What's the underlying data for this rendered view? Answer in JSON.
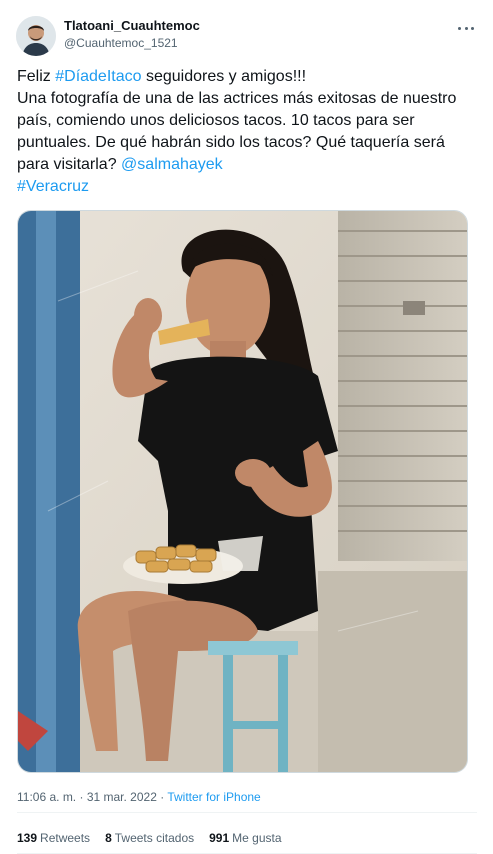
{
  "author": {
    "display_name": "Tlatoani_Cuauhtemoc",
    "handle": "@Cuauhtemoc_1521"
  },
  "tweet": {
    "line1_prefix": "Feliz ",
    "hashtag_dia": "#DíadeItaco",
    "line1_suffix": " seguidores y amigos!!!",
    "line2": "Una fotografía de una de las actrices más exitosas de nuestro país, comiendo unos deliciosos tacos. 10 tacos para ser puntuales. De qué habrán sido los tacos? Qué taquería será para visitarla? ",
    "mention": "@salmahayek",
    "hashtag_veracruz": "#Veracruz"
  },
  "meta": {
    "time": "11:06 a. m.",
    "separator": " · ",
    "date": "31 mar. 2022",
    "source": "Twitter for iPhone"
  },
  "stats": {
    "retweets_count": "139",
    "retweets_label": "Retweets",
    "quotes_count": "8",
    "quotes_label": "Tweets citados",
    "likes_count": "991",
    "likes_label": "Me gusta"
  },
  "icons": {
    "more": "more-options-icon"
  },
  "colors": {
    "link": "#1d9bf0",
    "text": "#0f1419",
    "muted": "#536471"
  }
}
